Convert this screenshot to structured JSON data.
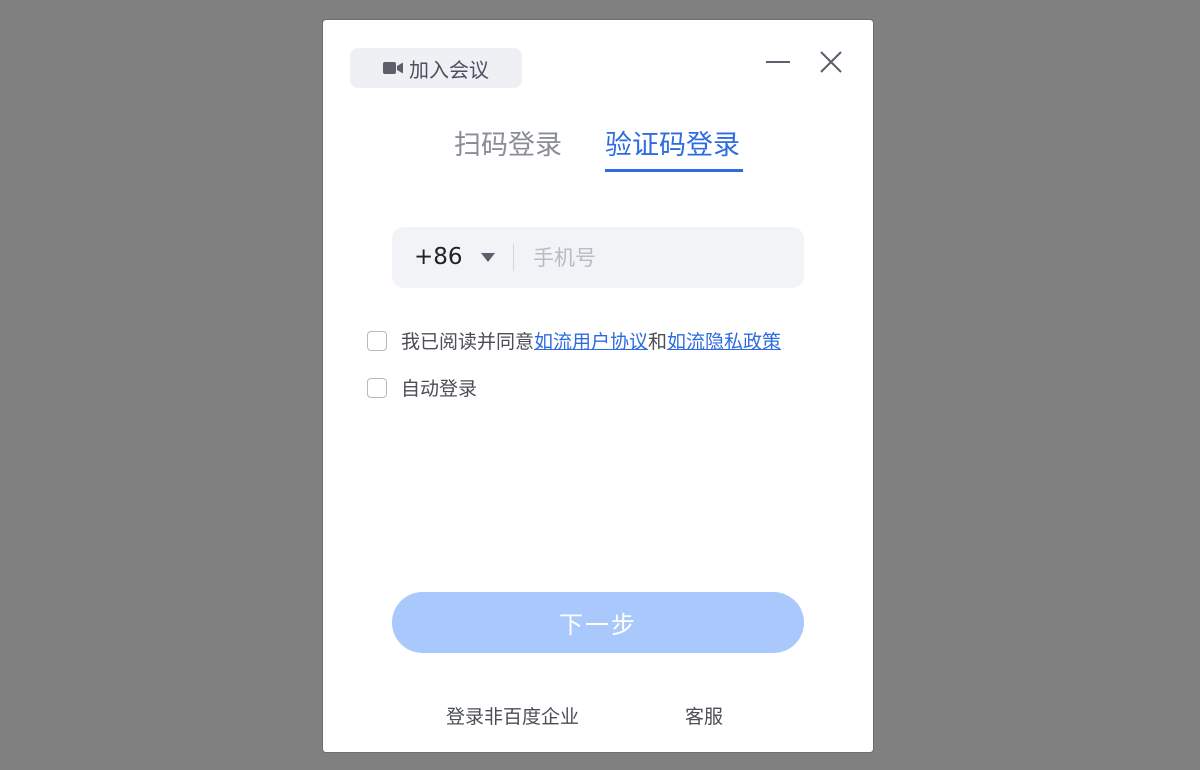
{
  "header": {
    "join_meeting_label": "加入会议"
  },
  "tabs": [
    {
      "label": "扫码登录",
      "active": false
    },
    {
      "label": "验证码登录",
      "active": true
    }
  ],
  "phone": {
    "country_code": "+86",
    "placeholder": "手机号",
    "value": ""
  },
  "agreement": {
    "prefix": "我已阅读并同意",
    "user_agreement": "如流用户协议",
    "conjunction": "和",
    "privacy_policy": "如流隐私政策",
    "checked": false
  },
  "auto_login": {
    "label": "自动登录",
    "checked": false
  },
  "next_button_label": "下一步",
  "footer": {
    "non_baidu_login": "登录非百度企业",
    "customer_service": "客服"
  },
  "colors": {
    "accent": "#2f6be0",
    "button_disabled": "#a9c8fc",
    "backdrop": "#808080"
  },
  "icons": [
    "video-camera-icon",
    "minimize-icon",
    "close-icon",
    "dropdown-triangle-icon"
  ]
}
